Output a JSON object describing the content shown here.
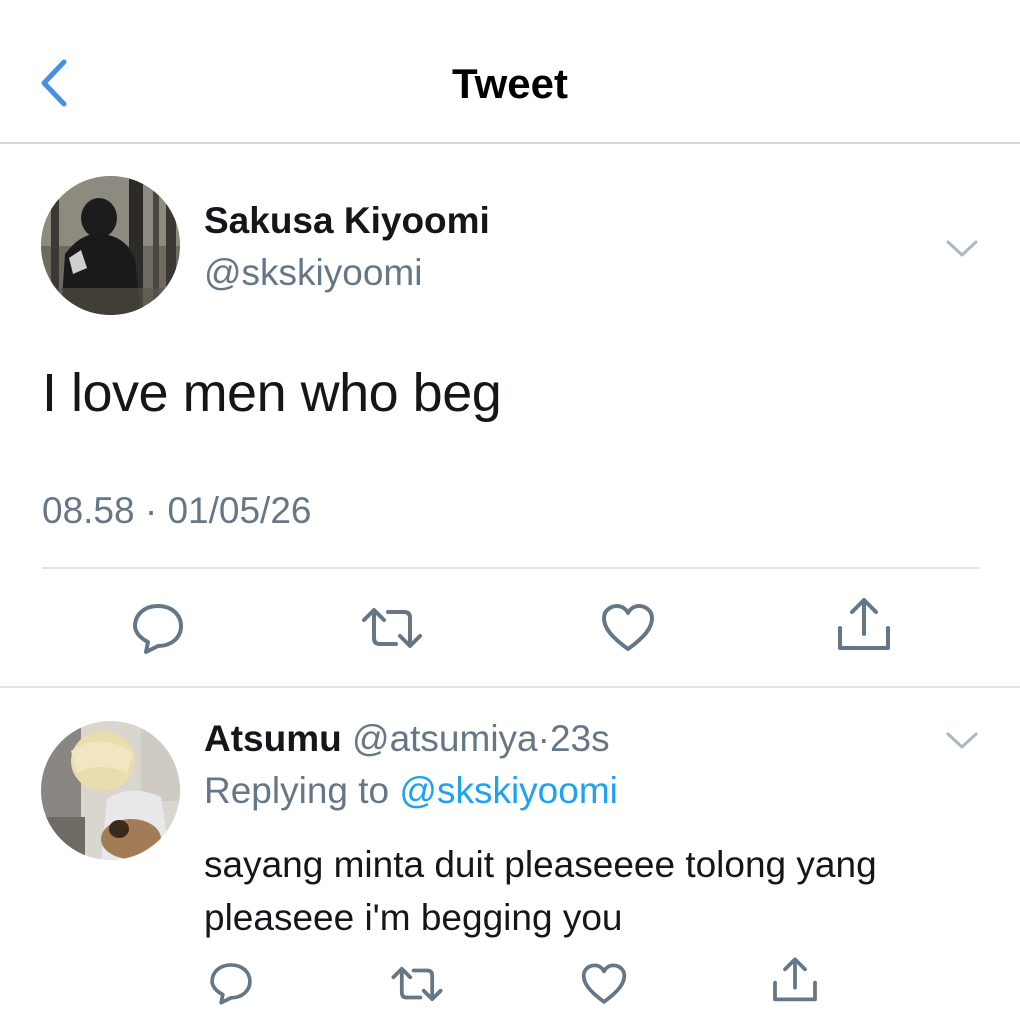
{
  "header": {
    "title": "Tweet"
  },
  "tweet": {
    "name": "Sakusa Kiyoomi",
    "handle": "@skskiyoomi",
    "text": "I love men who beg",
    "timestamp": "08.58 · 01/05/26"
  },
  "reply": {
    "name": "Atsumu",
    "handle": "@atsumiya",
    "separator": "·",
    "time": "23s",
    "replying_prefix": "Replying to",
    "replying_to": "@skskiyoomi",
    "text_line1": "sayang minta duit pleaseeee tolong yang",
    "text_line2": "pleaseee i'm begging you"
  },
  "colors": {
    "accent": "#1da1f2",
    "secondary_text": "#657786",
    "icon": "#657786",
    "divider": "#e1e6ea"
  },
  "icons": {
    "back": "chevron-left-icon",
    "more": "chevron-down-icon",
    "reply": "comment-icon",
    "retweet": "retweet-icon",
    "like": "heart-icon",
    "share": "share-icon"
  }
}
